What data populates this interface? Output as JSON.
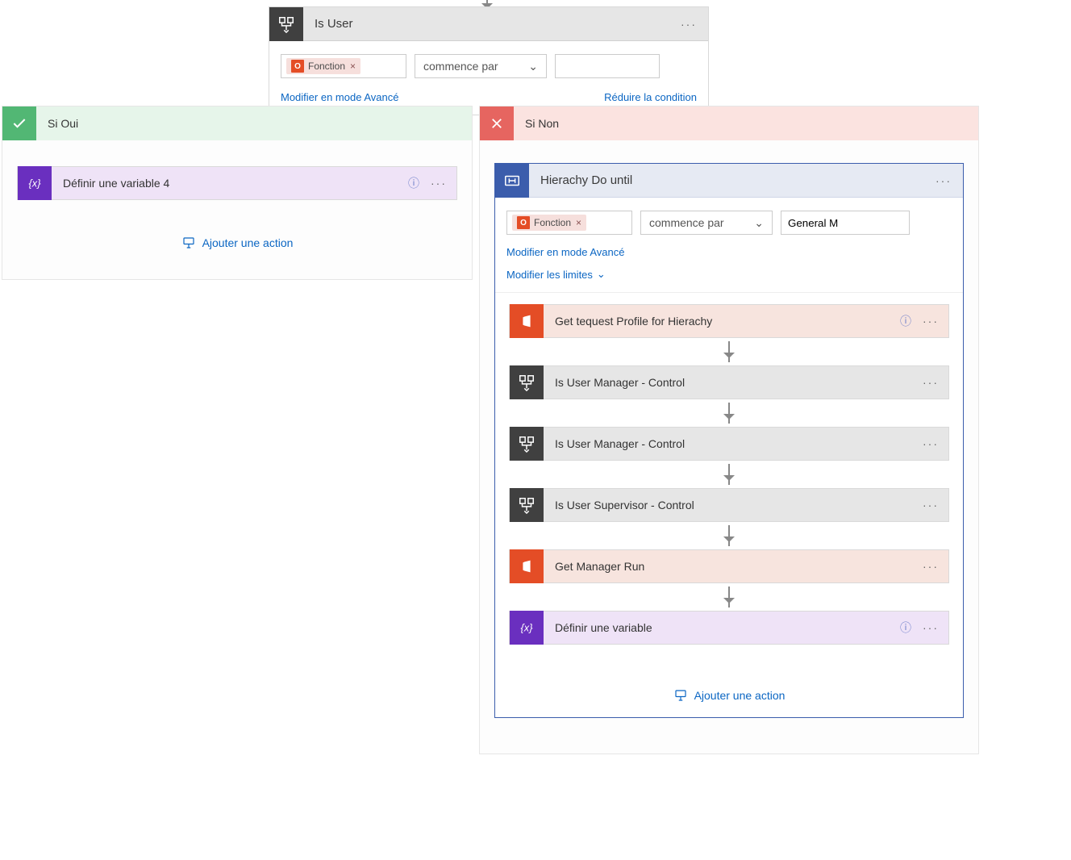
{
  "condition": {
    "title": "Is User",
    "token_label": "Fonction",
    "operator": "commence par",
    "value": "",
    "advanced_link": "Modifier en mode Avancé",
    "reduce_link": "Réduire la condition"
  },
  "yes_branch": {
    "title": "Si Oui",
    "action1": "Définir une variable 4",
    "add_action": "Ajouter une action"
  },
  "no_branch": {
    "title": "Si Non",
    "do_until": {
      "title": "Hierachy Do until",
      "token_label": "Fonction",
      "operator": "commence par",
      "value": "General M",
      "advanced_link": "Modifier en mode Avancé",
      "limits_link": "Modifier les limites",
      "steps": [
        {
          "label": "Get tequest Profile for Hierachy",
          "type": "o365",
          "help": true
        },
        {
          "label": "Is User      Manager - Control",
          "type": "ctl"
        },
        {
          "label": "Is User Manager - Control",
          "type": "ctl"
        },
        {
          "label": "Is User Supervisor - Control",
          "type": "ctl"
        },
        {
          "label": "Get Manager      Run",
          "type": "o365"
        },
        {
          "label": "Définir une variable",
          "type": "var",
          "help": true
        }
      ],
      "add_action": "Ajouter une action"
    }
  }
}
